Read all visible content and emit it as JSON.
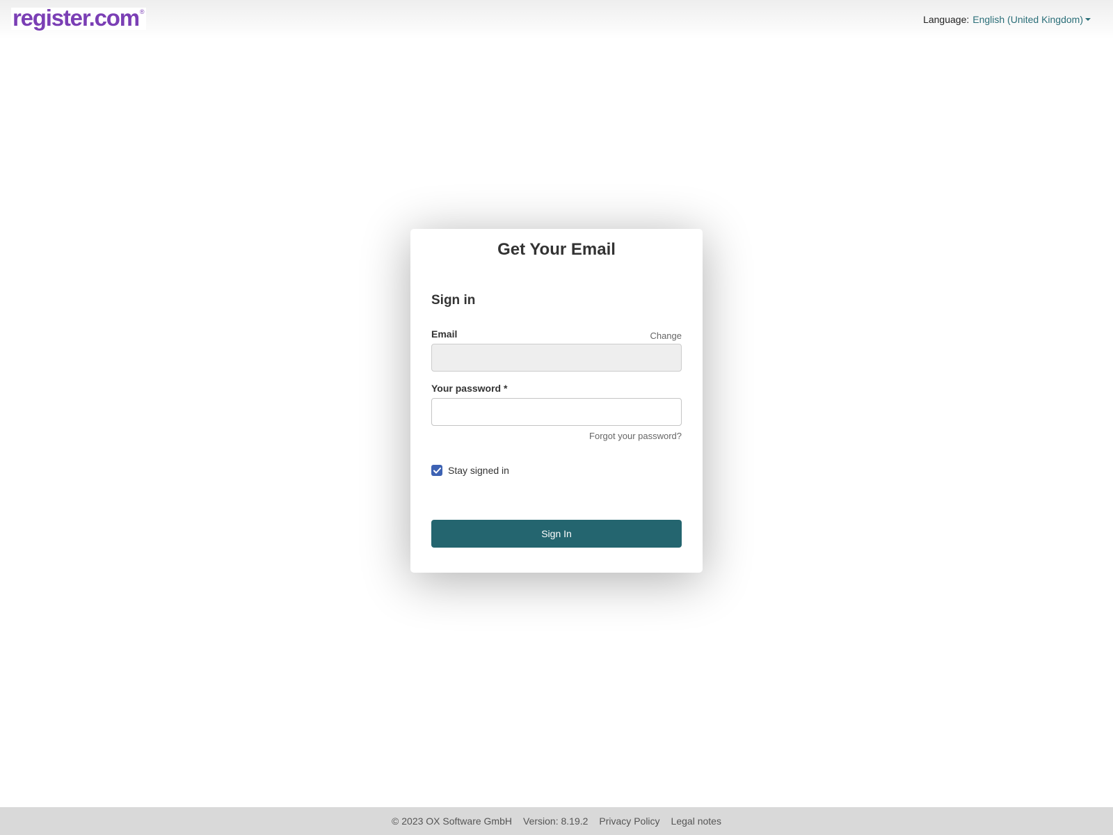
{
  "header": {
    "logo_text": "register.com",
    "logo_mark": "®",
    "language_label": "Language:",
    "language_value": "English (United Kingdom)"
  },
  "card": {
    "title": "Get Your Email",
    "signin_heading": "Sign in",
    "email_label": "Email",
    "email_value": "",
    "change_link": "Change",
    "password_label": "Your password *",
    "password_value": "",
    "forgot_link": "Forgot your password?",
    "stay_signed_in_label": "Stay signed in",
    "stay_signed_in_checked": true,
    "signin_button": "Sign In"
  },
  "footer": {
    "copyright": "© 2023 OX Software GmbH",
    "version": "Version: 8.19.2",
    "privacy": "Privacy Policy",
    "legal": "Legal notes"
  },
  "colors": {
    "brand": "#7b3fb5",
    "link": "#2a6e78",
    "primary_button": "#24656f",
    "checkbox": "#3d62b3",
    "footer_bg": "#d9d9d9"
  },
  "icons": {
    "checkbox_check": "check-icon",
    "language_caret": "caret-down-icon"
  }
}
